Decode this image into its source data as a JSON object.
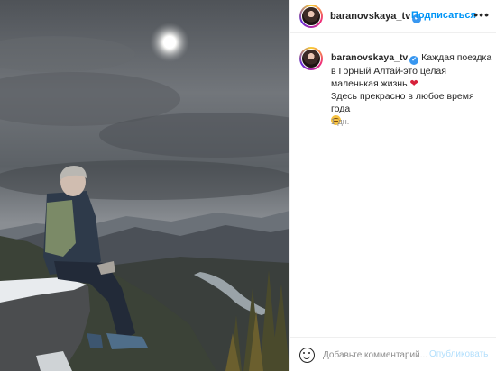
{
  "author": {
    "username": "baranovskaya_tv",
    "verified_badge": "✔",
    "follow_label": "Подписаться"
  },
  "caption": {
    "username": "baranovskaya_tv",
    "line1": "Каждая поездка в Горный Алтай-это целая маленькая жизнь",
    "line2": "Здесь прекрасно в любое время года",
    "heart": "❤"
  },
  "timestamp": "1 дн.",
  "composer": {
    "placeholder": "Добавьте комментарий...",
    "publish_label": "Опубликовать"
  },
  "icons": {
    "more": "more-options-icon",
    "emoji": "emoji-icon",
    "verified": "verified-icon"
  },
  "colors": {
    "link": "#0095f6",
    "publish_disabled": "#b2dffc",
    "verified": "#3897f0",
    "heart": "#d6203a"
  }
}
